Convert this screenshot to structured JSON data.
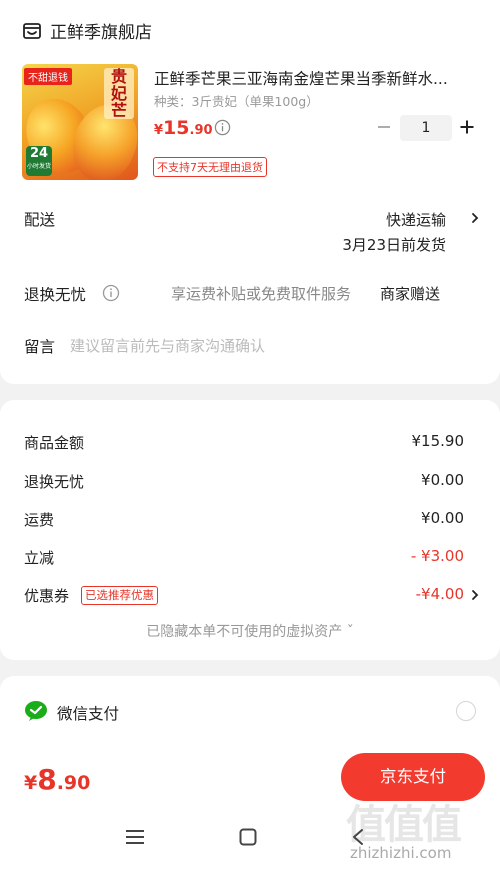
{
  "store": {
    "name": "正鲜季旗舰店",
    "icon": "store-icon"
  },
  "product": {
    "title": "正鲜季芒果三亚海南金煌芒果当季新鲜水...",
    "spec": "种类：3斤贵妃（单果100g）",
    "price_currency": "¥",
    "price_int": "15",
    "price_dec": ".90",
    "quantity": "1",
    "no_return_tag": "不支持7天无理由退货",
    "thumb_badge_left": "不甜退钱",
    "thumb_badge_right": "贵妃芒",
    "thumb_badge_hours": "24",
    "thumb_badge_hours_sub": "小时发货"
  },
  "shipping": {
    "label": "配送",
    "method": "快递运输",
    "date": "3月23日前发货"
  },
  "returns": {
    "label": "退换无忧",
    "service": "享运费补贴或免费取件服务",
    "gift": "商家赠送"
  },
  "note": {
    "label": "留言",
    "placeholder": "建议留言前先与商家沟通确认"
  },
  "fees": [
    {
      "label": "商品金额",
      "value": "¥15.90",
      "red": false
    },
    {
      "label": "退换无忧",
      "value": "¥0.00",
      "red": false
    },
    {
      "label": "运费",
      "value": "¥0.00",
      "red": false
    },
    {
      "label": "立减",
      "value": "- ¥3.00",
      "red": true
    },
    {
      "label": "优惠券",
      "value": "-¥4.00",
      "red": true
    }
  ],
  "coupon_tag": "已选推荐优惠",
  "hidden_note": "已隐藏本单不可使用的虚拟资产 ˇ",
  "payment": {
    "method": "微信支付"
  },
  "total": {
    "currency": "¥",
    "int": "8",
    "dec": ".90"
  },
  "pay_button": "京东支付",
  "watermark": {
    "big": "值值值",
    "small": "zhizhizhi.com"
  },
  "colors": {
    "accent": "#e8352a",
    "wechat_green": "#1aad19",
    "pay_button": "#f23a2f"
  }
}
